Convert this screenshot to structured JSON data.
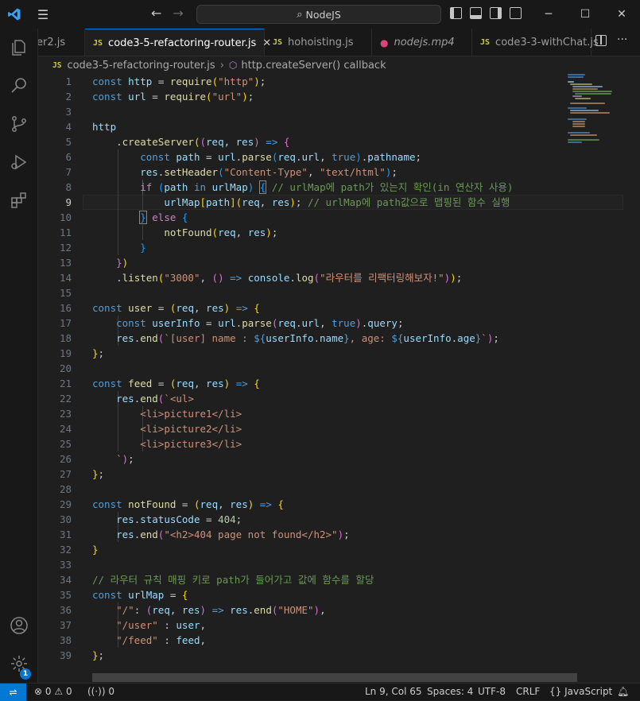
{
  "window": {
    "search_text": "NodeJS"
  },
  "tabs": [
    {
      "label": "er2.js"
    },
    {
      "label": "code3-5-refactoring-router.js"
    },
    {
      "label": "hohoisting.js"
    },
    {
      "label": "nodejs.mp4"
    },
    {
      "label": "code3-3-withChat.js"
    }
  ],
  "breadcrumb": {
    "file": "code3-5-refactoring-router.js",
    "symbol": "http.createServer() callback"
  },
  "editor": {
    "line_numbers": [
      "1",
      "2",
      "3",
      "4",
      "5",
      "6",
      "7",
      "8",
      "9",
      "10",
      "11",
      "12",
      "13",
      "14",
      "15",
      "16",
      "17",
      "18",
      "19",
      "20",
      "21",
      "22",
      "23",
      "24",
      "25",
      "26",
      "27",
      "28",
      "29",
      "30",
      "31",
      "32",
      "33",
      "34",
      "35",
      "36",
      "37",
      "38",
      "39"
    ],
    "current_line": 9
  },
  "status": {
    "errors": "0",
    "warnings": "0",
    "ports": "0",
    "position": "Ln 9, Col 65",
    "spaces": "Spaces: 4",
    "encoding": "UTF-8",
    "eol": "CRLF",
    "language": "JavaScript",
    "accounts_badge": "1"
  },
  "colors": {
    "accent": "#0078d4",
    "background": "#1f1f1f",
    "keyword": "#569cd6",
    "string": "#ce9178",
    "comment": "#6a9955"
  }
}
